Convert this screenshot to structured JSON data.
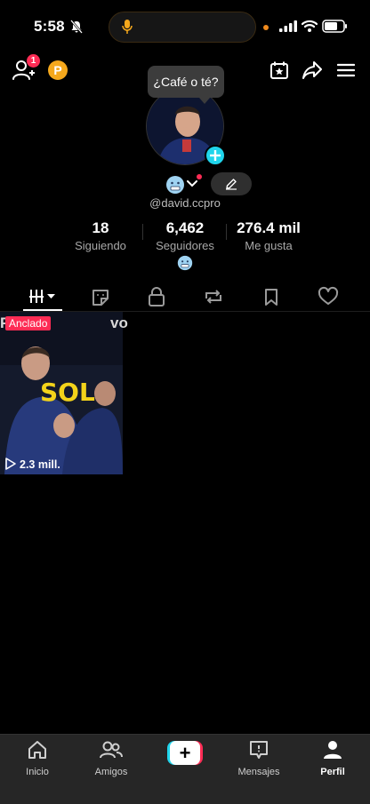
{
  "status_bar": {
    "time": "5:58"
  },
  "header": {
    "notification_count": "1",
    "coin_label": "P"
  },
  "profile": {
    "speech_bubble": "¿Café o té?",
    "username": "@david.ccpro",
    "stats": [
      {
        "value": "18",
        "label": "Siguiendo"
      },
      {
        "value": "6,462",
        "label": "Seguidores"
      },
      {
        "value": "276.4 mil",
        "label": "Me gusta"
      }
    ]
  },
  "tabs": [
    "videos",
    "favorites-sticker",
    "private",
    "reposts",
    "saved",
    "liked"
  ],
  "videos": [
    {
      "badge": "Anclado",
      "views": "2.3 mill.",
      "overlay_text": "SOL"
    }
  ],
  "bottom_nav": [
    {
      "label": "Inicio"
    },
    {
      "label": "Amigos"
    },
    {
      "label": ""
    },
    {
      "label": "Mensajes"
    },
    {
      "label": "Perfil"
    }
  ],
  "colors": {
    "accent": "#fe2c55",
    "cyan": "#20d5ec",
    "coin": "#f5a81c"
  }
}
